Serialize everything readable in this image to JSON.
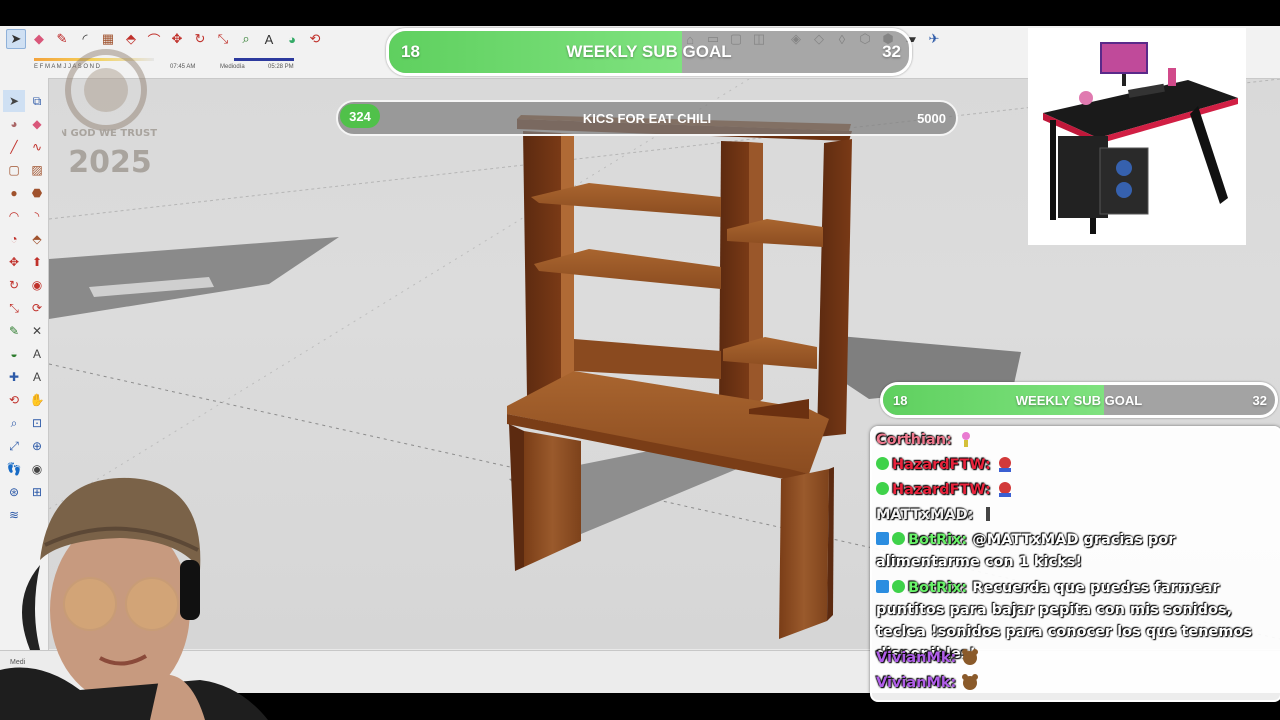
{
  "app": {
    "name": "SketchUp",
    "timebar": {
      "months": "E F M A M J J A S O N D",
      "time_left": "07:45 AM",
      "mid_label": "Mediodía",
      "time_right": "05:28 PM"
    },
    "status_label": "Medi"
  },
  "overlays": {
    "weekly_goal_top": {
      "title": "WEEKLY SUB GOAL",
      "current": "18",
      "target": "32",
      "progress": 0.5625
    },
    "kics_goal": {
      "title": "KICS FOR EAT CHILI",
      "current": "324",
      "target": "5000",
      "progress": 0.0648
    },
    "weekly_goal_side": {
      "title": "WEEKLY SUB GOAL",
      "current": "18",
      "target": "32",
      "progress": 0.5625
    },
    "watermark": {
      "text_top": "IN GOD WE TRUST",
      "year": "2025"
    }
  },
  "chat": {
    "messages": [
      {
        "user": "Corthian:",
        "text": "",
        "emote": "pink-emote"
      },
      {
        "user": "HazardFTW:",
        "text": "",
        "emote": "spider-emote"
      },
      {
        "user": "HazardFTW:",
        "text": "",
        "emote": "spider-emote"
      },
      {
        "user": "MATTxMAD:",
        "text": "",
        "emote": "figure-emote"
      },
      {
        "user": "BotRix:",
        "text": "@MATTxMAD gracias por alimentarme con 1 kicks!"
      },
      {
        "user": "BotRix:",
        "text": "Recuerda que puedes farmear puntitos para bajar pepita con mis sonidos, teclea !sonidos para conocer los que tenemos disponibles!"
      },
      {
        "user": "VivianMk:",
        "text": "",
        "emote": "bear-emote"
      },
      {
        "user": "VivianMk:",
        "text": "",
        "emote": "bear-emote"
      }
    ]
  },
  "colors": {
    "goal_green": "#5fd05f",
    "wood": "#8a4a1f",
    "chat_user_corthian": "#f07a8f",
    "chat_user_hazard": "#e8233c",
    "chat_user_botrix": "#6af26a",
    "chat_user_vivian": "#b05ee8"
  }
}
